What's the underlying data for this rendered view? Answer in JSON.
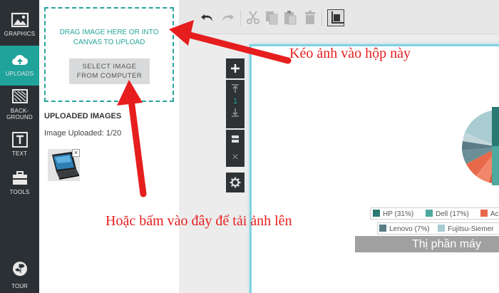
{
  "nav": {
    "items": [
      {
        "label": "GRAPHICS",
        "icon": "image-icon"
      },
      {
        "label": "UPLOADS",
        "icon": "cloud-upload-icon",
        "active": true
      },
      {
        "label_line1": "BACK-",
        "label_line2": "GROUND",
        "icon": "background-icon"
      },
      {
        "label": "TEXT",
        "icon": "text-icon"
      },
      {
        "label": "TOOLS",
        "icon": "toolbox-icon"
      }
    ],
    "tour": {
      "label": "TOUR",
      "icon": "signpost-icon"
    }
  },
  "upload": {
    "drop_line1": "DRAG IMAGE HERE OR INTO",
    "drop_line2": "CANVAS TO UPLOAD",
    "select_line1": "SELECT IMAGE",
    "select_line2": "FROM COMPUTER",
    "uploaded_title": "UPLOADED IMAGES",
    "uploaded_count": "Image Uploaded: 1/20",
    "thumb_close": "×"
  },
  "toolbar": {
    "buttons": [
      "undo-icon",
      "redo-icon",
      "cut-icon",
      "copy-icon",
      "paste-icon",
      "trash-icon",
      "crop-icon"
    ]
  },
  "side_tools": {
    "page_number": "1",
    "close": "×"
  },
  "chart": {
    "legend": [
      {
        "label": "HP (31%)",
        "color": "#2a7a73"
      },
      {
        "label": "Dell (17%)",
        "color": "#4fa99e"
      },
      {
        "label": "Ac",
        "color": "#e8694a"
      },
      {
        "label": "Lenovo (7%)",
        "color": "#5a7c86"
      },
      {
        "label": "Fujitsu-Siemer",
        "color": "#a9cbd2"
      }
    ],
    "title": "Thị phần máy"
  },
  "annotations": {
    "drag_hint": "Kéo ảnh vào hộp này",
    "click_hint": "Hoặc bấm vào đây để tải ảnh lên"
  },
  "colors": {
    "accent": "#1fa39a",
    "nav_bg": "#2b3034",
    "annotation": "#e61e1e"
  }
}
